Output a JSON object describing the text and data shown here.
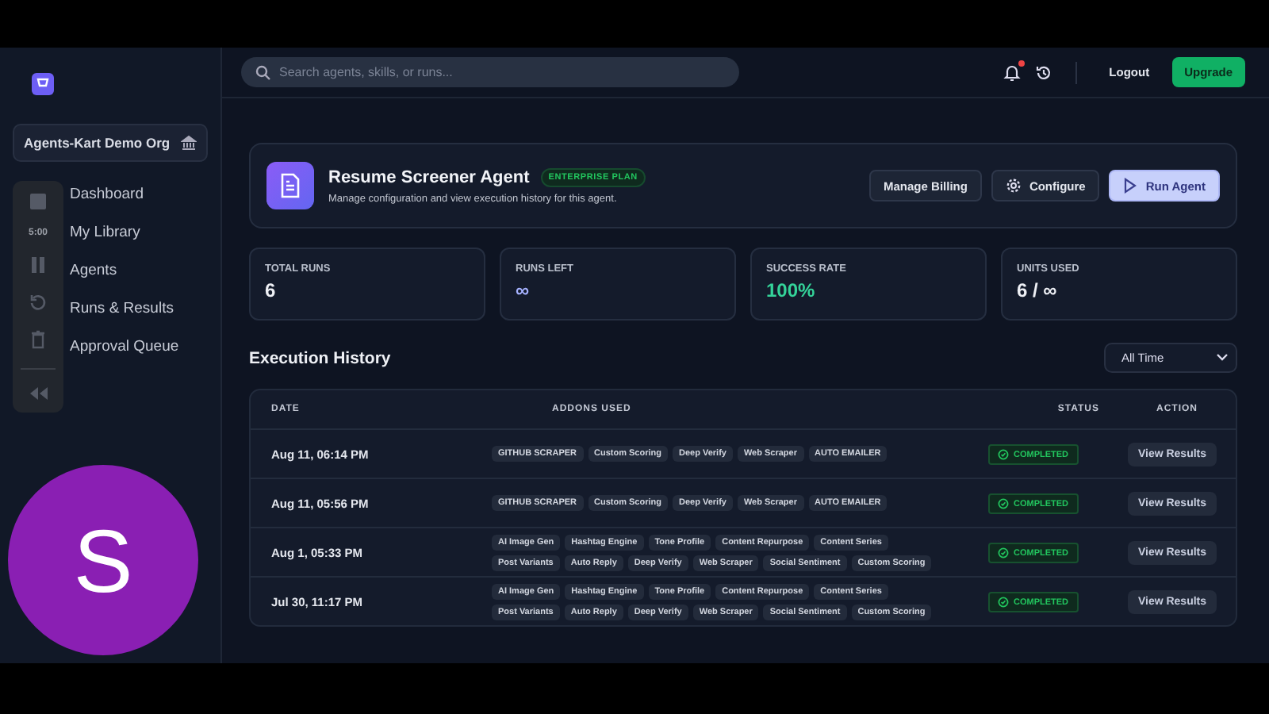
{
  "sidebar": {
    "org": "Agents-Kart Demo Org",
    "items": [
      {
        "label": "Dashboard"
      },
      {
        "label": "My Library"
      },
      {
        "label": "Agents"
      },
      {
        "label": "Runs & Results"
      },
      {
        "label": "Approval Queue"
      }
    ]
  },
  "search": {
    "placeholder": "Search agents, skills, or runs..."
  },
  "notifications": {
    "unread": true
  },
  "logout": "Logout",
  "upgrade": "Upgrade",
  "agent": {
    "name": "Resume Screener Agent",
    "plan": "ENTERPRISE PLAN",
    "description": "Manage configuration and view execution history for this agent.",
    "buttons": [
      {
        "label": "Manage Billing",
        "kind": "plain"
      },
      {
        "label": "Configure",
        "kind": "configure"
      },
      {
        "label": "Run Agent",
        "kind": "primary"
      }
    ]
  },
  "stats": [
    {
      "label": "TOTAL RUNS",
      "value": "6",
      "kind": "plain"
    },
    {
      "label": "RUNS LEFT",
      "value": "∞",
      "kind": "accent"
    },
    {
      "label": "SUCCESS RATE",
      "value": "100%",
      "kind": "success"
    },
    {
      "label": "UNITS USED",
      "value": "6 / ∞",
      "kind": "plain"
    }
  ],
  "history": {
    "title": "Execution History",
    "filter": "All Time",
    "columns": [
      "DATE",
      "ADDONS USED",
      "STATUS",
      "ACTION"
    ],
    "rows": [
      {
        "date": "Aug 11, 06:14 PM",
        "addons": [
          "GITHUB SCRAPER",
          "Custom Scoring",
          "Deep Verify",
          "Web Scraper",
          "AUTO EMAILER"
        ],
        "status": "COMPLETED",
        "kind": "completed",
        "action": "View Results"
      },
      {
        "date": "Aug 11, 05:56 PM",
        "addons": [
          "GITHUB SCRAPER",
          "Custom Scoring",
          "Deep Verify",
          "Web Scraper",
          "AUTO EMAILER"
        ],
        "status": "COMPLETED",
        "kind": "completed",
        "action": "View Results"
      },
      {
        "date": "Aug 1, 05:33 PM",
        "addons": [
          "AI Image Gen",
          "Hashtag Engine",
          "Tone Profile",
          "Content Repurpose",
          "Content Series",
          "Post Variants",
          "Auto Reply",
          "Deep Verify",
          "Web Scraper",
          "Social Sentiment",
          "Custom Scoring"
        ],
        "status": "COMPLETED",
        "kind": "completed",
        "action": "View Results"
      },
      {
        "date": "Jul 30, 11:17 PM",
        "addons": [
          "AI Image Gen",
          "Hashtag Engine",
          "Tone Profile",
          "Content Repurpose",
          "Content Series",
          "Post Variants",
          "Auto Reply",
          "Deep Verify",
          "Web Scraper",
          "Social Sentiment",
          "Custom Scoring"
        ],
        "status": "COMPLETED",
        "kind": "completed",
        "action": "View Results"
      }
    ]
  },
  "recorder": {
    "timer": "5:00"
  },
  "avatar": {
    "initial": "S"
  }
}
